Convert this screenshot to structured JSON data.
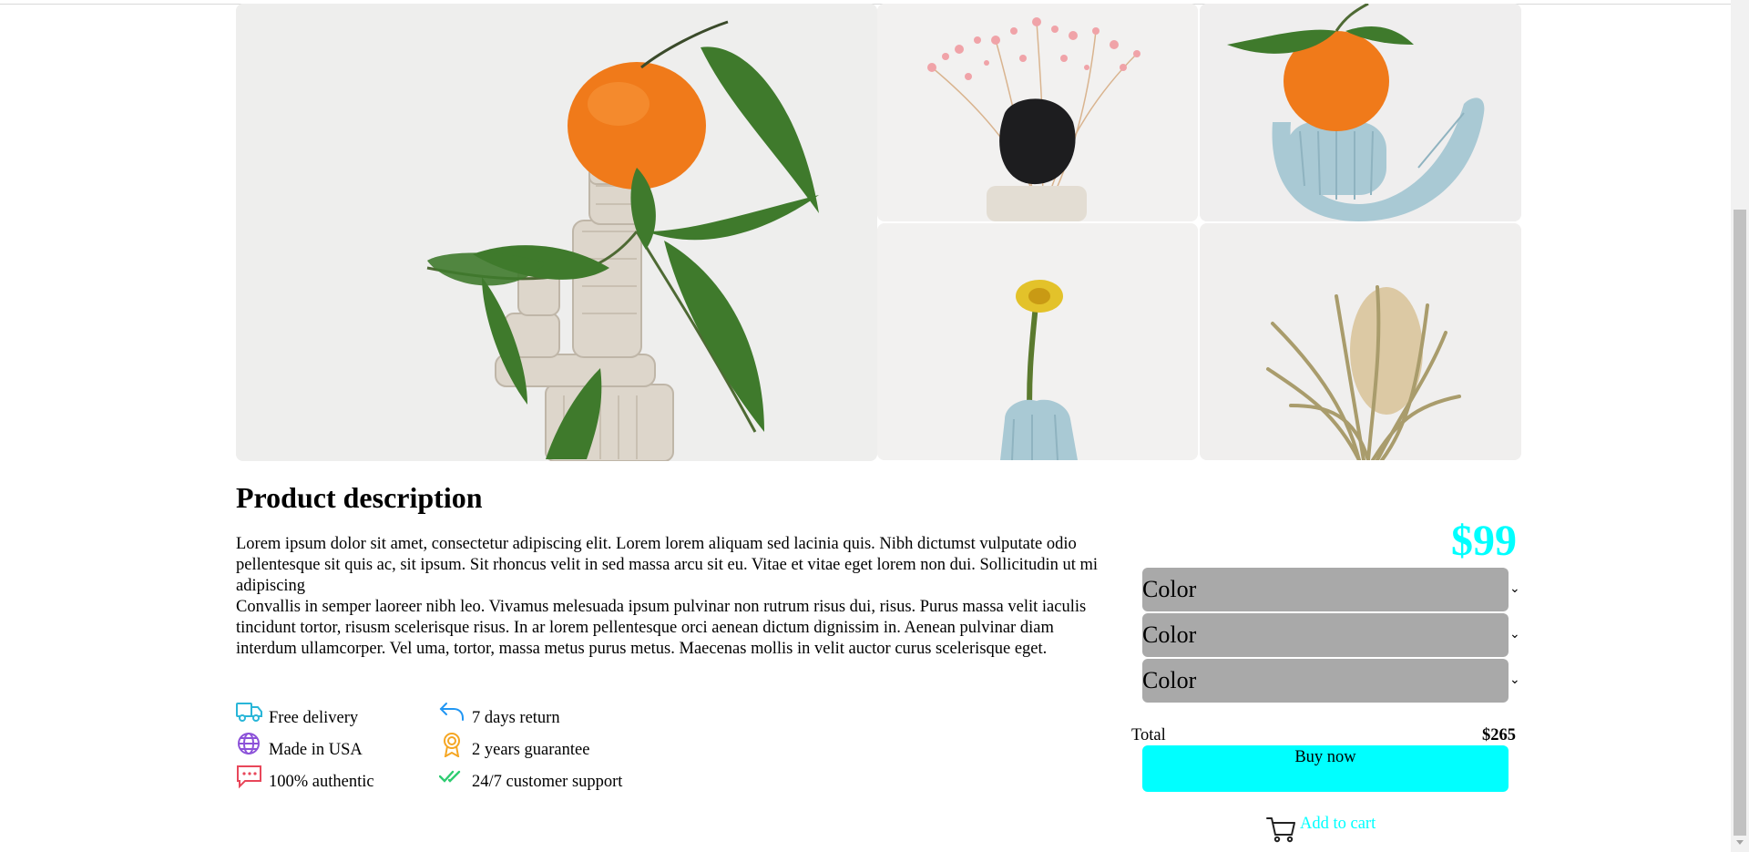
{
  "gallery": {
    "images": [
      {
        "subject": "orange-on-clay-stack"
      },
      {
        "subject": "pink-dried-flowers-black-stone"
      },
      {
        "subject": "orange-on-blue-clay-vase"
      },
      {
        "subject": "yellow-flower-blue-vase"
      },
      {
        "subject": "dried-banksia-flower"
      }
    ]
  },
  "product": {
    "title": "Product description",
    "paragraph1": "Lorem ipsum dolor sit amet, consectetur adipiscing elit. Lorem lorem aliquam sed lacinia quis. Nibh dictumst vulputate odio pellentesque sit quis ac, sit ipsum. Sit rhoncus velit in sed massa arcu sit eu. Vitae et vitae eget lorem non dui. Sollicitudin ut mi adipiscing",
    "paragraph2": "Convallis in semper laoreer nibh leo. Vivamus melesuada ipsum pulvinar non rutrum risus dui, risus. Purus massa velit iaculis tincidunt tortor, risusm scelerisque risus. In ar lorem pellentesque orci aenean dictum dignissim in. Aenean pulvinar diam interdum ullamcorper. Vel uma, tortor, massa metus purus metus. Maecenas mollis in velit auctor curus scelerisque eget."
  },
  "features": [
    {
      "label": "Free delivery",
      "icon": "truck-icon",
      "color": "#29b6d8"
    },
    {
      "label": "7 days return",
      "icon": "return-arrow-icon",
      "color": "#2196f3"
    },
    {
      "label": "Made in USA",
      "icon": "globe-icon",
      "color": "#8c52d9"
    },
    {
      "label": "2 years guarantee",
      "icon": "award-medal-icon",
      "color": "#f5a623"
    },
    {
      "label": "100% authentic",
      "icon": "chat-bubble-icon",
      "color": "#e8475a"
    },
    {
      "label": "24/7 customer support",
      "icon": "double-check-icon",
      "color": "#2ecc71"
    }
  ],
  "purchase": {
    "price": "$99",
    "selects": [
      {
        "value": "Color"
      },
      {
        "value": "Color"
      },
      {
        "value": "Color"
      }
    ],
    "total_label": "Total",
    "total_value": "$265",
    "buy_label": "Buy now",
    "add_to_cart_label": "Add to cart",
    "accent_color": "#00ffff",
    "select_color": "#a9a9a9"
  }
}
